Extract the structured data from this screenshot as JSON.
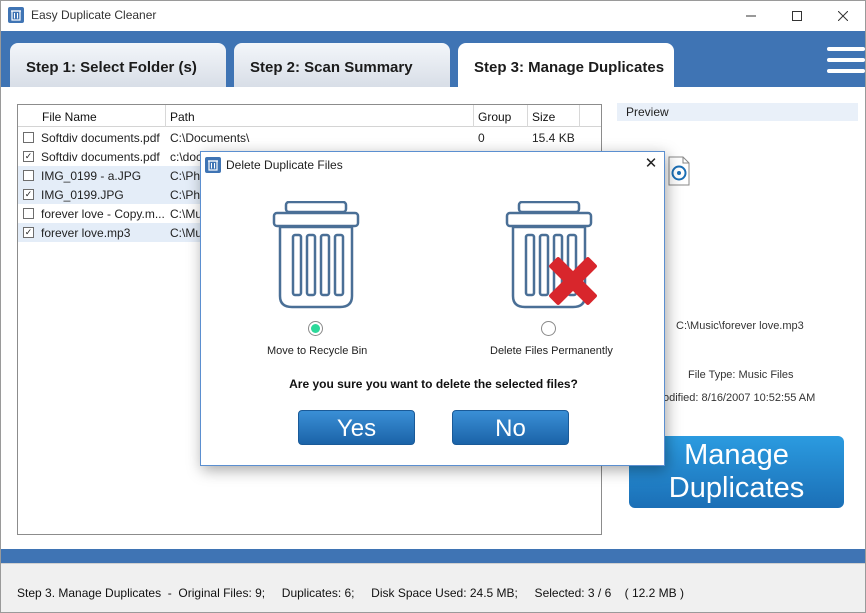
{
  "window": {
    "title": "Easy Duplicate Cleaner"
  },
  "tabs": [
    {
      "label": "Step 1: Select Folder (s)"
    },
    {
      "label": "Step 2: Scan Summary"
    },
    {
      "label": "Step 3: Manage Duplicates",
      "active": true
    }
  ],
  "grid": {
    "columns": [
      "File Name",
      "Path",
      "Group",
      "Size"
    ],
    "rows": [
      {
        "checked": false,
        "name": "Softdiv documents.pdf",
        "path": "C:\\Documents\\",
        "group": "0",
        "size": "15.4 KB"
      },
      {
        "checked": true,
        "name": "Softdiv documents.pdf",
        "path": "c:\\doc",
        "group": "",
        "size": ""
      },
      {
        "checked": false,
        "name": "IMG_0199 - a.JPG",
        "path": "C:\\Ph",
        "group": "",
        "size": ""
      },
      {
        "checked": true,
        "name": "IMG_0199.JPG",
        "path": "C:\\Ph",
        "group": "",
        "size": ""
      },
      {
        "checked": false,
        "name": "forever love - Copy.m...",
        "path": "C:\\Mu",
        "group": "",
        "size": ""
      },
      {
        "checked": true,
        "name": "forever love.mp3",
        "path": "C:\\Mu",
        "group": "",
        "size": ""
      }
    ]
  },
  "preview": {
    "header": "Preview",
    "path": "C:\\Music\\forever love.mp3",
    "file_type": "File Type: Music Files",
    "modified": "odified: 8/16/2007 10:52:55 AM"
  },
  "manage_button": {
    "line1": "Manage",
    "line2": "Duplicates"
  },
  "status": "Step 3. Manage Duplicates  -  Original Files: 9;     Duplicates: 6;     Disk Space Used: 24.5 MB;     Selected: 3 / 6    ( 12.2 MB )",
  "dialog": {
    "title": "Delete Duplicate Files",
    "option_recycle": "Move to Recycle Bin",
    "option_permanent": "Delete Files Permanently",
    "selected_option": "Move to Recycle Bin",
    "question": "Are you sure you want to delete the selected files?",
    "yes": "Yes",
    "no": "No"
  },
  "colors": {
    "accent": "#3f74b4",
    "button": "#1b6fb6",
    "radio_selected": "#2cd99a",
    "delete_x": "#d8262c"
  }
}
